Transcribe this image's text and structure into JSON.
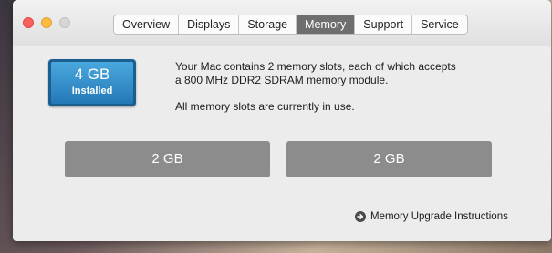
{
  "tabs": [
    {
      "label": "Overview",
      "active": false
    },
    {
      "label": "Displays",
      "active": false
    },
    {
      "label": "Storage",
      "active": false
    },
    {
      "label": "Memory",
      "active": true
    },
    {
      "label": "Support",
      "active": false
    },
    {
      "label": "Service",
      "active": false
    }
  ],
  "memory": {
    "total": "4 GB",
    "total_label": "Installed",
    "description_line1": "Your Mac contains 2 memory slots, each of which accepts",
    "description_line2": "a 800 MHz DDR2 SDRAM memory module.",
    "status": "All memory slots are currently in use.",
    "slots": [
      {
        "label": "2 GB"
      },
      {
        "label": "2 GB"
      }
    ]
  },
  "upgrade_link": {
    "label": "Memory Upgrade Instructions",
    "icon": "arrow-circle-right-icon"
  },
  "colors": {
    "badge_blue": "#2478b8",
    "active_tab": "#6e6e6e",
    "slot_gray": "#8c8c8c"
  }
}
